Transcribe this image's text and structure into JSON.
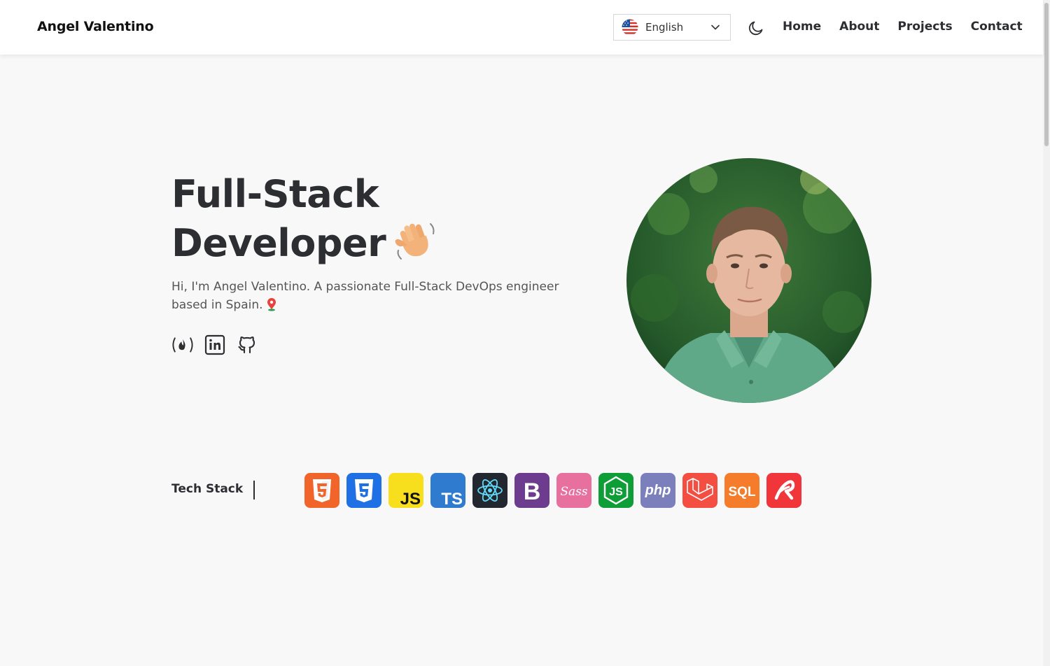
{
  "header": {
    "brand": "Angel Valentino",
    "language": {
      "selected": "English",
      "flag_icon": "us-flag-icon"
    },
    "theme_icon": "moon-icon",
    "nav": [
      "Home",
      "About",
      "Projects",
      "Contact"
    ]
  },
  "hero": {
    "title_line1": "Full-Stack",
    "title_line2": "Developer",
    "title_emoji": "waving-hand-icon",
    "intro": "Hi, I'm Angel Valentino. A passionate Full-Stack DevOps engineer based in Spain.",
    "location_icon": "location-pin-icon",
    "socials": [
      "freecodecamp-icon",
      "linkedin-icon",
      "github-icon"
    ],
    "portrait": "profile-photo"
  },
  "tech_stack": {
    "label": "Tech Stack",
    "icons": [
      {
        "name": "html5-icon",
        "color": "#e44d26",
        "text": "5"
      },
      {
        "name": "css3-icon",
        "color": "#1572b6",
        "text": "3"
      },
      {
        "name": "javascript-icon",
        "color": "#f7df1e",
        "text": "JS"
      },
      {
        "name": "typescript-icon",
        "color": "#3178c6",
        "text": "TS"
      },
      {
        "name": "react-icon",
        "color": "#222222",
        "text": ""
      },
      {
        "name": "bootstrap-icon",
        "color": "#7952b3",
        "text": "B"
      },
      {
        "name": "sass-icon",
        "color": "#cd6799",
        "text": "Sass"
      },
      {
        "name": "nodejs-icon",
        "color": "#0f9d38",
        "text": "JS"
      },
      {
        "name": "php-icon",
        "color": "#777bb4",
        "text": "php"
      },
      {
        "name": "laravel-icon",
        "color": "#ff2d20",
        "text": ""
      },
      {
        "name": "sql-icon",
        "color": "#f36f21",
        "text": "SQL"
      },
      {
        "name": "rollup-icon",
        "color": "#ef3335",
        "text": ""
      }
    ]
  }
}
